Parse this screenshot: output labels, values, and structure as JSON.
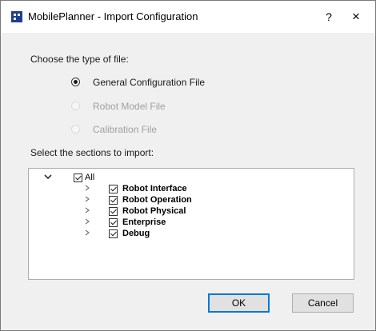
{
  "window": {
    "title": "MobilePlanner - Import Configuration",
    "help_label": "?",
    "close_label": "×"
  },
  "file_type": {
    "heading": "Choose the type of file:",
    "options": [
      {
        "label": "General Configuration File",
        "selected": true,
        "enabled": true
      },
      {
        "label": "Robot Model File",
        "selected": false,
        "enabled": false
      },
      {
        "label": "Calibration File",
        "selected": false,
        "enabled": false
      }
    ]
  },
  "sections": {
    "heading": "Select the sections to import:",
    "root": {
      "label": "All",
      "checked": true,
      "expanded": true
    },
    "children": [
      {
        "label": "Robot Interface",
        "checked": true
      },
      {
        "label": "Robot Operation",
        "checked": true
      },
      {
        "label": "Robot Physical",
        "checked": true
      },
      {
        "label": "Enterprise",
        "checked": true
      },
      {
        "label": "Debug",
        "checked": true
      }
    ]
  },
  "buttons": {
    "ok_label": "OK",
    "cancel_label": "Cancel"
  },
  "icons": {
    "app": "mobileplanner-app-icon",
    "expand": "chevron-right-icon",
    "collapse": "chevron-down-icon"
  }
}
